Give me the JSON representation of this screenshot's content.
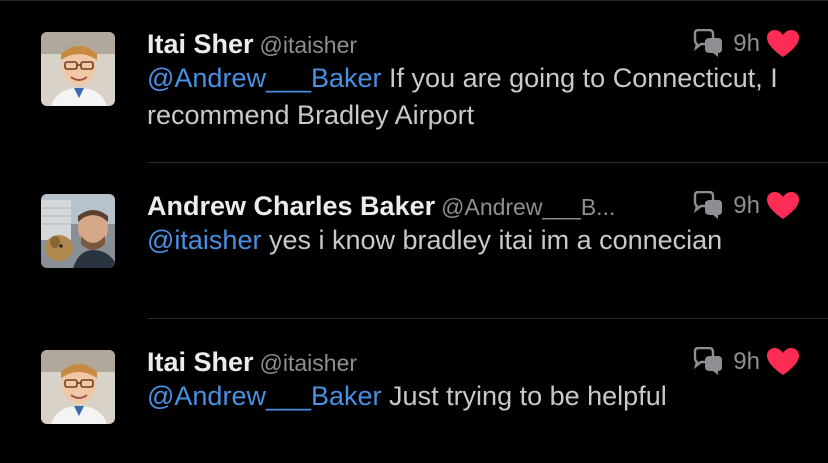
{
  "tweets": [
    {
      "name": "Itai Sher",
      "handle": "@itaisher",
      "mention": "@Andrew___Baker",
      "text": " If you are going to Connecticut, I recommend Bradley Airport",
      "time": "9h",
      "avatar_icon": "avatar-itai-sher"
    },
    {
      "name": "Andrew Charles Baker",
      "handle": "@Andrew___B...",
      "mention": "@itaisher",
      "text": " yes i know bradley itai im a connecian",
      "time": "9h",
      "avatar_icon": "avatar-andrew-baker"
    },
    {
      "name": "Itai Sher",
      "handle": "@itaisher",
      "mention": "@Andrew___Baker",
      "text": " Just trying to be helpful",
      "time": "9h",
      "avatar_icon": "avatar-itai-sher"
    }
  ],
  "colors": {
    "background": "#000000",
    "mention": "#4a90e2",
    "heart": "#ff2d55",
    "secondary_text": "#8e8e93"
  },
  "icons": {
    "reply": "conversation-bubble-icon",
    "like": "heart-icon"
  }
}
